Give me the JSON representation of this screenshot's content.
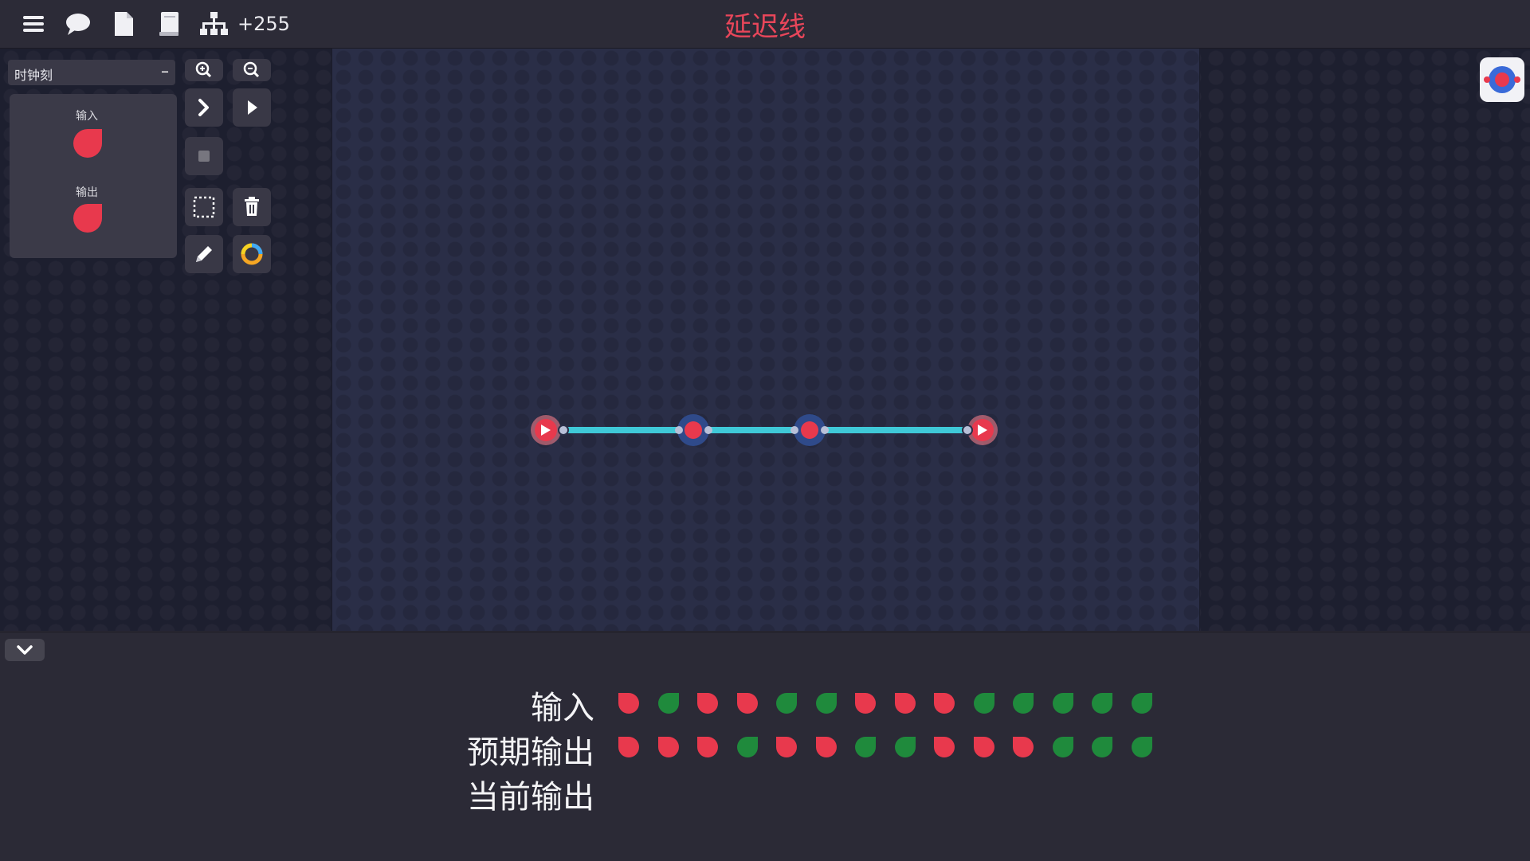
{
  "topbar": {
    "level_count": "+255",
    "title": "延迟线",
    "icons": [
      "menu-icon",
      "chat-icon",
      "file-icon",
      "book-icon",
      "hierarchy-icon"
    ]
  },
  "left_panel": {
    "clock_label": "时钟刻",
    "clock_action": "–",
    "input_label": "输入",
    "output_label": "输出"
  },
  "tools": [
    "zoom-in-icon",
    "zoom-out-icon",
    "step-icon",
    "play-icon",
    "stop-icon",
    "select-icon",
    "trash-icon",
    "pencil-icon",
    "color-wheel-icon"
  ],
  "colors": {
    "red": "#e8394d",
    "green": "#1f8a3c",
    "wire": "#3fc9d8",
    "title": "#e8465a"
  },
  "bottom": {
    "rows": [
      {
        "label": "输入",
        "values": [
          "r",
          "g",
          "r",
          "r",
          "g",
          "g",
          "r",
          "r",
          "r",
          "g",
          "g",
          "g",
          "g",
          "g"
        ]
      },
      {
        "label": "预期输出",
        "values": [
          "r",
          "r",
          "r",
          "g",
          "r",
          "r",
          "g",
          "g",
          "r",
          "r",
          "r",
          "g",
          "g",
          "g"
        ]
      },
      {
        "label": "当前输出",
        "values": []
      }
    ]
  }
}
